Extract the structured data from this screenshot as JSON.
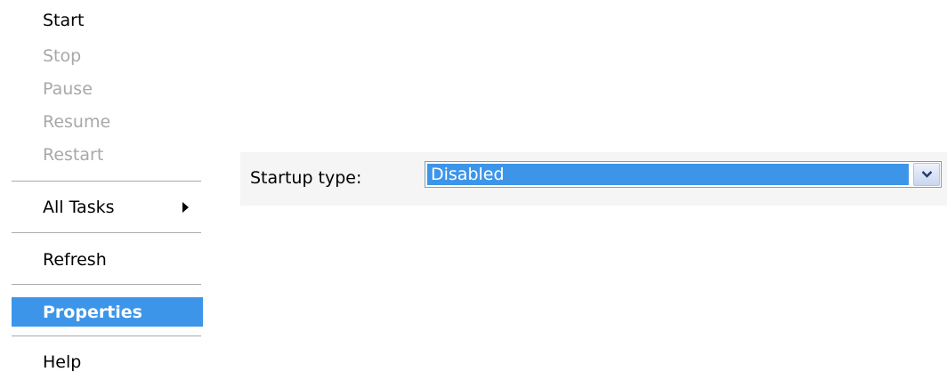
{
  "context_menu": {
    "items": [
      {
        "label": "Start",
        "enabled": true
      },
      {
        "label": "Stop",
        "enabled": false
      },
      {
        "label": "Pause",
        "enabled": false
      },
      {
        "label": "Resume",
        "enabled": false
      },
      {
        "label": "Restart",
        "enabled": false
      },
      {
        "label": "All Tasks",
        "enabled": true,
        "has_submenu": true
      },
      {
        "label": "Refresh",
        "enabled": true
      },
      {
        "label": "Properties",
        "enabled": true,
        "selected": true
      },
      {
        "label": "Help",
        "enabled": true
      }
    ],
    "submenu_icon": "chevron-right-icon"
  },
  "properties": {
    "startup_type_label": "Startup type:",
    "startup_type_value": "Disabled",
    "dropdown_icon": "chevron-down-icon"
  },
  "colors": {
    "selection": "#3d95ea",
    "disabled_text": "#a8a8a8",
    "panel_background": "#f5f5f5"
  }
}
